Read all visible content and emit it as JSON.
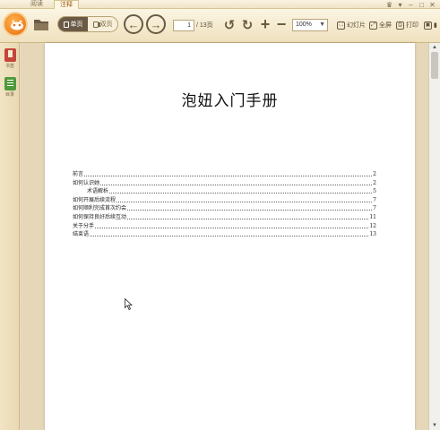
{
  "tabs": [
    {
      "label": "阅读"
    },
    {
      "label": "注释"
    }
  ],
  "window_controls": [
    "♛",
    "▾",
    "–",
    "□",
    "✕"
  ],
  "toolbar": {
    "single_page_label": "单页",
    "double_page_label": "双页",
    "current_page": "1",
    "total_pages": "/ 13页",
    "zoom_value": "100%",
    "slideshow_label": "幻灯片",
    "fullscreen_label": "全屏",
    "print_label": "打印",
    "more_label": "▮"
  },
  "sidebar": {
    "items": [
      {
        "label": "书签"
      },
      {
        "label": "目录"
      }
    ]
  },
  "document": {
    "title": "泡妞入门手册",
    "toc": [
      {
        "text": "前言",
        "page": "2",
        "indent": false
      },
      {
        "text": "如何认识她",
        "page": "2",
        "indent": false
      },
      {
        "text": "术语解析",
        "page": "5",
        "indent": true
      },
      {
        "text": "如何开展后续流程",
        "page": "7",
        "indent": false
      },
      {
        "text": "如何顺利完成首次约会",
        "page": "7",
        "indent": false
      },
      {
        "text": "如何保持良好后续互动",
        "page": "11",
        "indent": false
      },
      {
        "text": "关于分手",
        "page": "12",
        "indent": false
      },
      {
        "text": "结束语",
        "page": "13",
        "indent": false
      }
    ]
  },
  "colors": {
    "accent": "#e56f10",
    "toolbar_bg": "#f4e8cc",
    "page_bg": "#ffffff"
  }
}
